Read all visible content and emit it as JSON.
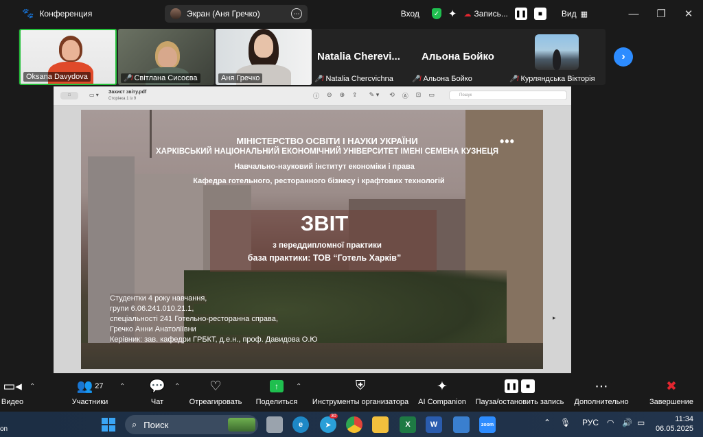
{
  "app": {
    "title": "Конференция"
  },
  "share": {
    "label": "Экран (Аня Гречко)"
  },
  "topbar": {
    "login": "Вход",
    "record_label": "Запись...",
    "view_label": "Вид"
  },
  "participants": [
    {
      "name": "Oksana Davydova",
      "muted": false
    },
    {
      "name": "Світлана Сисоєва",
      "muted": true
    },
    {
      "name": "Аня Гречко",
      "muted": false
    },
    {
      "name": "Natalia Chercvichna",
      "display": "Natalia  Cherevi...",
      "muted": true
    },
    {
      "name": "Альона Бойко",
      "display": "Альона Бойко",
      "muted": true
    },
    {
      "name": "Курляндська Вікторія",
      "muted": true
    }
  ],
  "pdf": {
    "filename": "Захист звіту.pdf",
    "pages": "Сторінка 1 із 9",
    "search_placeholder": "Пошук",
    "sidebar_btn": "□"
  },
  "slide": {
    "ministry": "МІНІСТЕРСТВО ОСВІТИ І НАУКИ УКРАЇНИ",
    "university": "ХАРКІВСЬКИЙ НАЦІОНАЛЬНИЙ ЕКОНОМІЧНИЙ УНІВЕРСИТЕТ ІМЕНІ СЕМЕНА КУЗНЕЦЯ",
    "institute": "Навчально-науковий інститут економіки і права",
    "department": "Кафедра готельного, ресторанного бізнесу і крафтових технологій",
    "title": "ЗВІТ",
    "subtitle1": "з переддипломної практики",
    "subtitle2": "база практики: ТОВ “Готель Харків”",
    "info": [
      "Студентки 4 року навчання,",
      "групи 6.06.241.010.21.1,",
      "спеціальності 241 Готельно-ресторанна справа,",
      "Гречко Анни Анатоліївни",
      "Керівник: зав. кафедри ГРБКТ, д.е.н., проф. Давидова О.Ю"
    ]
  },
  "toolbar": {
    "video": "Видео",
    "participants": "Участники",
    "participants_count": "27",
    "chat": "Чат",
    "react": "Отреагировать",
    "share": "Поделиться",
    "host_tools": "Инструменты организатора",
    "ai": "AI Companion",
    "pause_record": "Пауза/остановить запись",
    "more": "Дополнительно",
    "end": "Завершение"
  },
  "taskbar": {
    "search": "Поиск",
    "lang": "РУС",
    "time": "11:34",
    "date": "06.05.2025",
    "telegram_badge": "30",
    "left_fragment": "on"
  },
  "colors": {
    "accent_green": "#1fbf4f",
    "zoom_blue": "#2d8cff",
    "end_red": "#e0262f"
  }
}
